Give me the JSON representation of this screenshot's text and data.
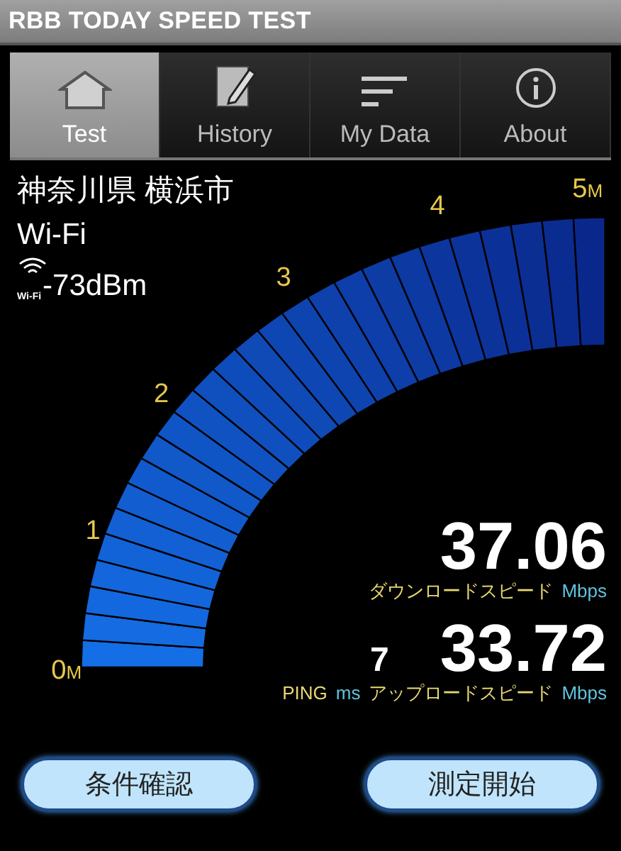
{
  "app_title": "RBB TODAY SPEED TEST",
  "tabs": [
    {
      "label": "Test",
      "selected": true
    },
    {
      "label": "History",
      "selected": false
    },
    {
      "label": "My Data",
      "selected": false
    },
    {
      "label": "About",
      "selected": false
    }
  ],
  "location": "神奈川県 横浜市",
  "network": "Wi-Fi",
  "signal": {
    "badge": "Wi-Fi",
    "reading": "-73dBm"
  },
  "gauge": {
    "scale": [
      {
        "value": "0",
        "unit": "M"
      },
      {
        "value": "1"
      },
      {
        "value": "2"
      },
      {
        "value": "3"
      },
      {
        "value": "4"
      },
      {
        "value": "5",
        "unit": "M"
      }
    ]
  },
  "download": {
    "value": "37.06",
    "label": "ダウンロードスピード",
    "unit": "Mbps"
  },
  "ping": {
    "value": "7",
    "label": "PING",
    "unit": "ms"
  },
  "upload": {
    "value": "33.72",
    "label": "アップロードスピード",
    "unit": "Mbps"
  },
  "buttons": [
    {
      "label": "条件確認"
    },
    {
      "label": "測定開始"
    }
  ]
}
